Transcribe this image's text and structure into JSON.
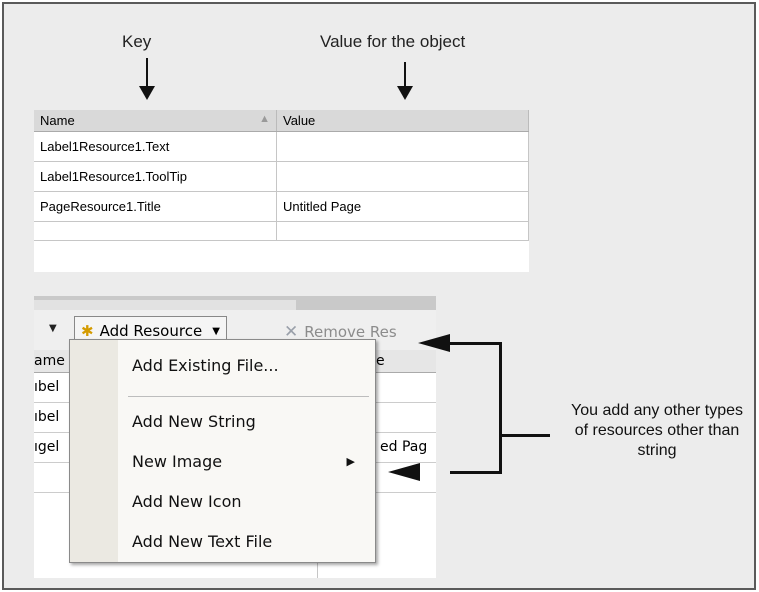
{
  "annotations": {
    "key_label": "Key",
    "value_label": "Value for the object",
    "callout": "You add any other types of resources other than string"
  },
  "top_grid": {
    "columns": [
      "Name",
      "Value"
    ],
    "sort_indicator": "▲",
    "rows": [
      {
        "name": "Label1Resource1.Text",
        "value": ""
      },
      {
        "name": "Label1Resource1.ToolTip",
        "value": ""
      },
      {
        "name": "PageResource1.Title",
        "value": "Untitled Page"
      },
      {
        "name": "",
        "value": ""
      }
    ]
  },
  "toolbar": {
    "add_resource_label": "Add Resource",
    "remove_resource_label": "Remove Res",
    "dropdown_arrow": "▼"
  },
  "bottom_grid": {
    "header_left": "ame",
    "header_right": "e",
    "rows": [
      {
        "left": "ıbel",
        "right": ""
      },
      {
        "left": "ıbel",
        "right": ""
      },
      {
        "left": "ıgel",
        "right": "ed Pag"
      },
      {
        "left": "",
        "right": ""
      }
    ]
  },
  "menu": {
    "items": [
      {
        "label": "Add Existing File..."
      },
      {
        "label": "Add New String"
      },
      {
        "label": "New Image",
        "has_submenu": true
      },
      {
        "label": "Add New Icon"
      },
      {
        "label": "Add New Text File"
      }
    ],
    "submenu_arrow": "▶"
  },
  "icons": {
    "add_resource": "new-resource-icon",
    "remove_resource": "delete-x-icon"
  }
}
